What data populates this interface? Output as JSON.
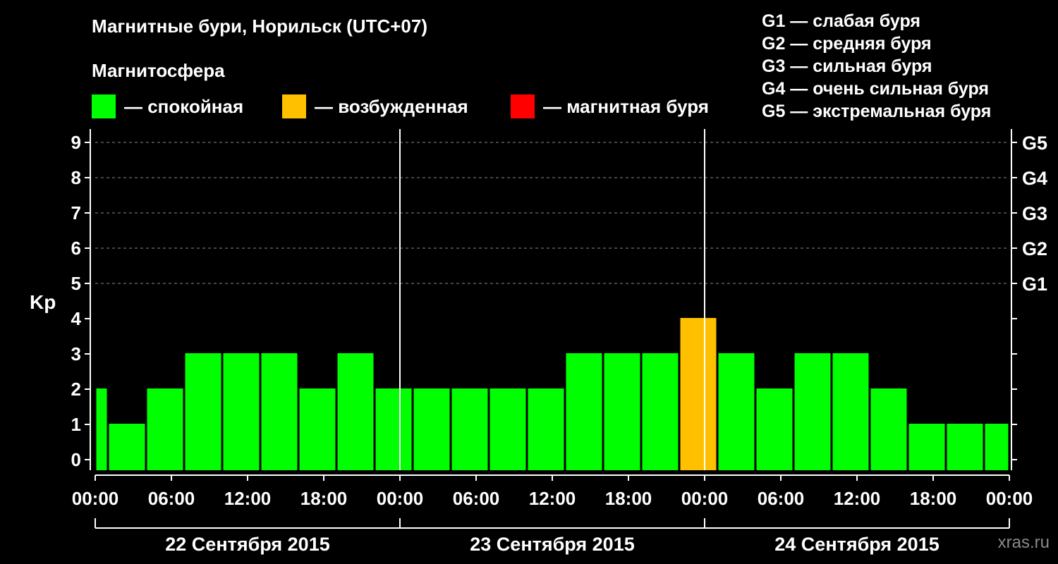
{
  "title": "Магнитные бури, Норильск (UTC+07)",
  "subtitle": "Магнитосфера",
  "legend": [
    {
      "label": "— спокойная",
      "color": "#00ff00"
    },
    {
      "label": "— возбужденная",
      "color": "#ffc000"
    },
    {
      "label": "— магнитная буря",
      "color": "#ff0000"
    }
  ],
  "g_levels": [
    "G1 — слабая буря",
    "G2 — средняя буря",
    "G3 — сильная буря",
    "G4 — очень сильная буря",
    "G5 — экстремальная буря"
  ],
  "watermark": "xras.ru",
  "chart_data": {
    "type": "bar",
    "ylabel": "Kp",
    "ylim": [
      0,
      9
    ],
    "yticks": [
      "0",
      "1",
      "2",
      "3",
      "4",
      "5",
      "6",
      "7",
      "8",
      "9"
    ],
    "right_ticks": [
      {
        "y": 5,
        "label": "G1"
      },
      {
        "y": 6,
        "label": "G2"
      },
      {
        "y": 7,
        "label": "G3"
      },
      {
        "y": 8,
        "label": "G4"
      },
      {
        "y": 9,
        "label": "G5"
      }
    ],
    "grid_dashed_at": [
      5,
      6,
      7,
      8,
      9
    ],
    "xticks": [
      "00:00",
      "06:00",
      "12:00",
      "18:00",
      "00:00",
      "06:00",
      "12:00",
      "18:00",
      "00:00",
      "06:00",
      "12:00",
      "18:00",
      "00:00"
    ],
    "days": [
      "22 Сентября 2015",
      "23 Сентября 2015",
      "24 Сентября 2015"
    ],
    "interval_hours": 3,
    "bars": [
      {
        "start_hour": 0,
        "end_hour": 1,
        "value": 2
      },
      {
        "start_hour": 1,
        "end_hour": 4,
        "value": 1
      },
      {
        "start_hour": 4,
        "end_hour": 7,
        "value": 2
      },
      {
        "start_hour": 7,
        "end_hour": 10,
        "value": 3
      },
      {
        "start_hour": 10,
        "end_hour": 13,
        "value": 3
      },
      {
        "start_hour": 13,
        "end_hour": 16,
        "value": 3
      },
      {
        "start_hour": 16,
        "end_hour": 19,
        "value": 2
      },
      {
        "start_hour": 19,
        "end_hour": 22,
        "value": 3
      },
      {
        "start_hour": 22,
        "end_hour": 25,
        "value": 2
      },
      {
        "start_hour": 25,
        "end_hour": 28,
        "value": 2
      },
      {
        "start_hour": 28,
        "end_hour": 31,
        "value": 2
      },
      {
        "start_hour": 31,
        "end_hour": 34,
        "value": 2
      },
      {
        "start_hour": 34,
        "end_hour": 37,
        "value": 2
      },
      {
        "start_hour": 37,
        "end_hour": 40,
        "value": 3
      },
      {
        "start_hour": 40,
        "end_hour": 43,
        "value": 3
      },
      {
        "start_hour": 43,
        "end_hour": 46,
        "value": 3
      },
      {
        "start_hour": 46,
        "end_hour": 49,
        "value": 4
      },
      {
        "start_hour": 49,
        "end_hour": 52,
        "value": 3
      },
      {
        "start_hour": 52,
        "end_hour": 55,
        "value": 2
      },
      {
        "start_hour": 55,
        "end_hour": 58,
        "value": 3
      },
      {
        "start_hour": 58,
        "end_hour": 61,
        "value": 3
      },
      {
        "start_hour": 61,
        "end_hour": 64,
        "value": 2
      },
      {
        "start_hour": 64,
        "end_hour": 67,
        "value": 1
      },
      {
        "start_hour": 67,
        "end_hour": 70,
        "value": 1
      },
      {
        "start_hour": 70,
        "end_hour": 72,
        "value": 1
      }
    ],
    "colors": {
      "quiet": "#00ff00",
      "active": "#ffc000",
      "storm": "#ff0000"
    }
  }
}
